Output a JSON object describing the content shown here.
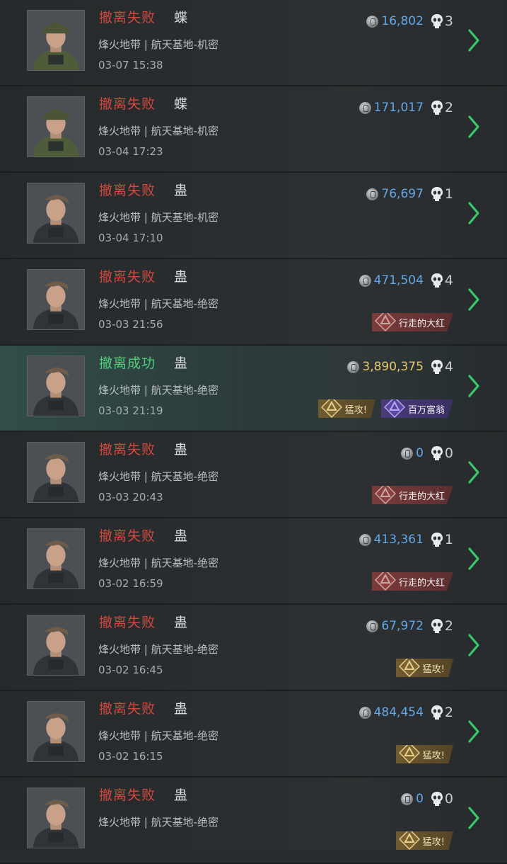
{
  "colors": {
    "fail": "#d2463c",
    "success": "#4fcf79",
    "value_blue": "#63a7e6",
    "value_gold": "#e6c86a",
    "chevron": "#39c86a"
  },
  "icons": {
    "currency": "coin-icon",
    "kills": "skull-icon",
    "open": "chevron-right-icon"
  },
  "records": [
    {
      "status": "撤离失败",
      "result": "fail",
      "operator": "蝶",
      "map": "烽火地带 | 航天基地-机密",
      "time": "03-07 15:38",
      "value": "16,802",
      "kills": "3",
      "badges": []
    },
    {
      "status": "撤离失败",
      "result": "fail",
      "operator": "蝶",
      "map": "烽火地带 | 航天基地-机密",
      "time": "03-04 17:23",
      "value": "171,017",
      "kills": "2",
      "badges": []
    },
    {
      "status": "撤离失败",
      "result": "fail",
      "operator": "蛊",
      "map": "烽火地带 | 航天基地-机密",
      "time": "03-04 17:10",
      "value": "76,697",
      "kills": "1",
      "badges": []
    },
    {
      "status": "撤离失败",
      "result": "fail",
      "operator": "蛊",
      "map": "烽火地带 | 航天基地-绝密",
      "time": "03-03 21:56",
      "value": "471,504",
      "kills": "4",
      "badges": [
        {
          "label": "行走的大红",
          "style": "red"
        }
      ]
    },
    {
      "status": "撤离成功",
      "result": "success",
      "operator": "蛊",
      "map": "烽火地带 | 航天基地-绝密",
      "time": "03-03 21:19",
      "value": "3,890,375",
      "kills": "4",
      "badges": [
        {
          "label": "猛攻!",
          "style": "gold"
        },
        {
          "label": "百万富翁",
          "style": "purple"
        }
      ]
    },
    {
      "status": "撤离失败",
      "result": "fail",
      "operator": "蛊",
      "map": "烽火地带 | 航天基地-绝密",
      "time": "03-03 20:43",
      "value": "0",
      "kills": "0",
      "badges": [
        {
          "label": "行走的大红",
          "style": "red"
        }
      ]
    },
    {
      "status": "撤离失败",
      "result": "fail",
      "operator": "蛊",
      "map": "烽火地带 | 航天基地-绝密",
      "time": "03-02 16:59",
      "value": "413,361",
      "kills": "1",
      "badges": [
        {
          "label": "行走的大红",
          "style": "red"
        }
      ]
    },
    {
      "status": "撤离失败",
      "result": "fail",
      "operator": "蛊",
      "map": "烽火地带 | 航天基地-绝密",
      "time": "03-02 16:45",
      "value": "67,972",
      "kills": "2",
      "badges": [
        {
          "label": "猛攻!",
          "style": "gold"
        }
      ]
    },
    {
      "status": "撤离失败",
      "result": "fail",
      "operator": "蛊",
      "map": "烽火地带 | 航天基地-绝密",
      "time": "03-02 16:15",
      "value": "484,454",
      "kills": "2",
      "badges": [
        {
          "label": "猛攻!",
          "style": "gold"
        }
      ]
    },
    {
      "status": "撤离失败",
      "result": "fail",
      "operator": "蛊",
      "map": "烽火地带 | 航天基地-绝密",
      "time": "",
      "value": "0",
      "kills": "0",
      "badges": [
        {
          "label": "猛攻!",
          "style": "gold"
        }
      ]
    }
  ]
}
